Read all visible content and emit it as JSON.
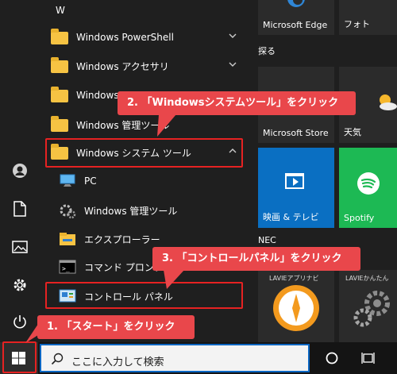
{
  "start_menu": {
    "section_letter": "W",
    "apps": [
      {
        "label": "Windows PowerShell",
        "type": "folder",
        "expanded": false
      },
      {
        "label": "Windows アクセサリ",
        "type": "folder",
        "expanded": false
      },
      {
        "label": "Windows",
        "type": "folder",
        "expanded": false
      },
      {
        "label": "Windows 管理ツール",
        "type": "folder",
        "expanded": false
      },
      {
        "label": "Windows システム ツール",
        "type": "folder",
        "expanded": true
      }
    ],
    "subitems": [
      {
        "label": "PC",
        "icon": "pc-icon"
      },
      {
        "label": "Windows 管理ツール",
        "icon": "admin-tools-icon"
      },
      {
        "label": "エクスプローラー",
        "icon": "file-explorer-icon"
      },
      {
        "label": "コマンド プロンプト",
        "icon": "command-prompt-icon"
      },
      {
        "label": "コントロール パネル",
        "icon": "control-panel-icon"
      }
    ]
  },
  "tiles": {
    "edge": "Microsoft Edge",
    "photos": "フォト",
    "explore_group": "探る",
    "store": "Microsoft Store",
    "weather": "天気",
    "movies": "映画 & テレビ",
    "spotify": "Spotify",
    "nec_group": "NEC",
    "lavie_app": "LAVIEアプリナビ",
    "lavie_easy": "LAVIEかんたん"
  },
  "taskbar": {
    "search_placeholder": "ここに入力して検索"
  },
  "annotations": {
    "step1": "1. 「スタート」をクリック",
    "step2": "2. 「Windowsシステムツール」をクリック",
    "step3": "3. 「コントロールパネル」をクリック",
    "color": "#e9474b"
  },
  "colors": {
    "background": "#1f1f1f",
    "folder": "#f6c343",
    "tile_blue": "#0a6fc2",
    "spotify_green": "#1db954",
    "highlight_red": "#e62222"
  }
}
